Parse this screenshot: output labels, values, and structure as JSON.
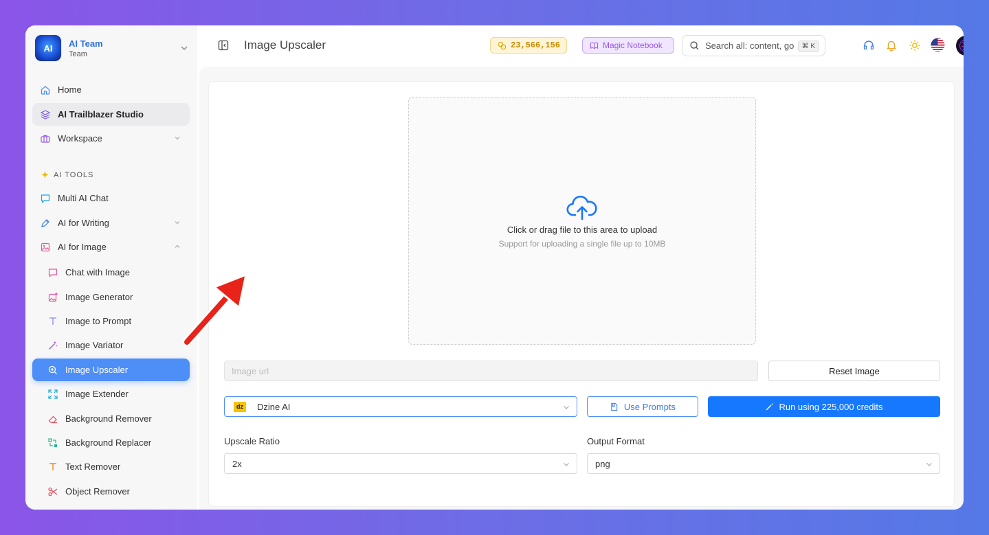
{
  "team": {
    "logo_text": "AI",
    "name": "AI Team",
    "subtitle": "Team"
  },
  "sidebar": {
    "items": [
      {
        "label": "Home",
        "icon": "home-icon"
      },
      {
        "label": "AI Trailblazer Studio",
        "icon": "layers-icon",
        "active": true
      },
      {
        "label": "Workspace",
        "icon": "briefcase-icon",
        "expandable": true
      }
    ],
    "section_label": "AI TOOLS",
    "tools": [
      {
        "label": "Multi AI Chat",
        "icon": "chat-icon"
      },
      {
        "label": "AI for Writing",
        "icon": "pen-icon",
        "expandable": true
      },
      {
        "label": "AI for Image",
        "icon": "image-icon",
        "expanded": true
      }
    ],
    "image_tools": [
      {
        "label": "Chat with Image",
        "icon": "chat-bubble-icon"
      },
      {
        "label": "Image Generator",
        "icon": "image-plus-icon"
      },
      {
        "label": "Image to Prompt",
        "icon": "text-t-icon"
      },
      {
        "label": "Image Variator",
        "icon": "magic-wand-icon"
      },
      {
        "label": "Image Upscaler",
        "icon": "zoom-in-icon",
        "active": true
      },
      {
        "label": "Image Extender",
        "icon": "expand-icon"
      },
      {
        "label": "Background Remover",
        "icon": "eraser-icon"
      },
      {
        "label": "Background Replacer",
        "icon": "replace-icon"
      },
      {
        "label": "Text Remover",
        "icon": "text-t-icon"
      },
      {
        "label": "Object Remover",
        "icon": "scissors-icon"
      }
    ]
  },
  "header": {
    "page_title": "Image Upscaler",
    "credits": "23,566,156",
    "notebook_label": "Magic Notebook",
    "search_placeholder": "Search all: content, go",
    "search_shortcut": "⌘ K"
  },
  "upload": {
    "title": "Click or drag file to this area to upload",
    "hint": "Support for uploading a single file up to 10MB"
  },
  "controls": {
    "url_placeholder": "Image url",
    "reset_label": "Reset Image",
    "model_badge": "dz",
    "model_name": "Dzine AI",
    "prompts_label": "Use Prompts",
    "run_label": "Run using 225,000 credits",
    "upscale_label": "Upscale Ratio",
    "upscale_value": "2x",
    "format_label": "Output Format",
    "format_value": "png"
  },
  "colors": {
    "accent": "#1677ff",
    "active_nav": "#4e8ef7",
    "credits_text": "#c48a00",
    "notebook_text": "#9a5ae6",
    "annotation_arrow": "#e8231a"
  }
}
